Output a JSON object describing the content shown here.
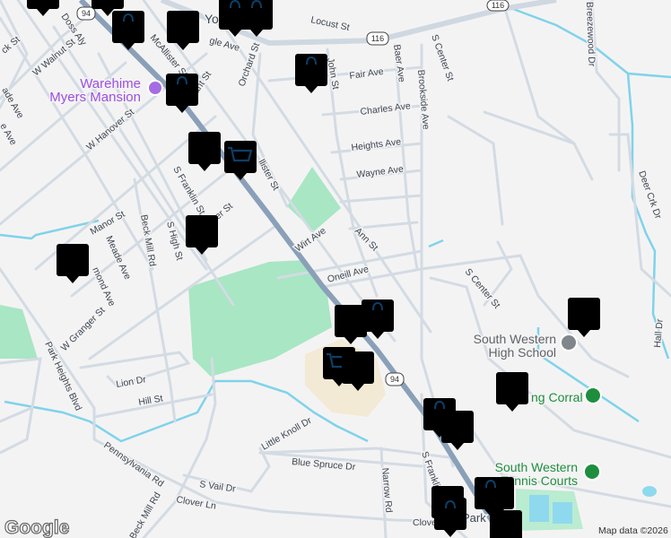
{
  "map": {
    "streets": {
      "ck_st": "ck St",
      "doss_aly": "Doss Aly",
      "w_walnut": "W Walnut St",
      "mcallister_n": "McAllister St",
      "gle_ave": "gle Ave",
      "yo": "Yo",
      "locust": "Locust St",
      "orchard": "Orchard St",
      "john": "John St",
      "fair": "Fair Ave",
      "baer": "Baer Ave",
      "brookside": "Brookside Ave",
      "s_center_n": "S Center St",
      "charles": "Charles Ave",
      "heights": "Heights Ave",
      "wayne": "Wayne Ave",
      "breezewood": "Breezewood Dr",
      "deer_crk": "Deer Crk Dr",
      "hall": "Hall Dr",
      "w_hanover": "W Hanover St",
      "ant_st": "ant St",
      "s_franklin_n": "S Franklin St",
      "llister": "llister St",
      "er_st": "er St",
      "manor": "Manor St",
      "beck_mill_n": "Beck Mill Rd",
      "s_high": "S High St",
      "meade": "Meade Ave",
      "mond": "mond Ave",
      "wirt": "Wirt Ave",
      "ann": "Ann St",
      "oneill": "Oneill Ave",
      "s_center_s": "S Center St",
      "w_granger": "W Granger St",
      "park_heights": "Park Heights Blvd",
      "lion": "Lion Dr",
      "hill": "Hill St",
      "little_knoll": "Little Knoll Dr",
      "blue_spruce": "Blue Spruce Dr",
      "pennsylvania": "Pennsylvania Rd",
      "s_vail": "S Vail Dr",
      "clover": "Clover Ln",
      "beck_mill_s": "Beck Mill Rd",
      "narrow": "Narrow Rd",
      "s_franklin_s": "S Franklin St",
      "clove": "Clove",
      "park": "Park",
      "ade_ave": "ade Ave",
      "e_ave": "e Ave"
    },
    "routes": [
      "94",
      "116",
      "116",
      "94"
    ],
    "places": {
      "warehime_1": "Warehime",
      "warehime_2": "Myers Mansion",
      "swhs_1": "South Western",
      "swhs_2": "High School",
      "corral": "ng Corral",
      "tennis_1": "South Western",
      "tennis_2": "Tennis Courts"
    },
    "attribution": "Map data ©2026",
    "logo": "Google",
    "colors": {
      "pin_fill": "#e3ebfb",
      "pin_icon": "#0d3e66",
      "park": "#a8e6c4",
      "water": "#7fd3ea",
      "highway": "#8aa0b8"
    }
  }
}
